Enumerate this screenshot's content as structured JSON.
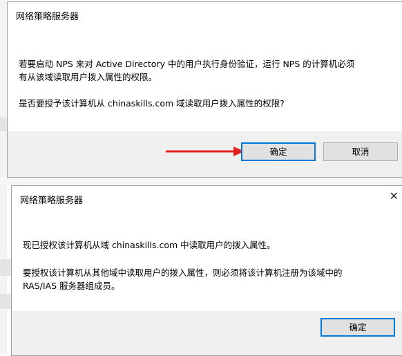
{
  "dialog1": {
    "title": "网络策略服务器",
    "close_glyph": "",
    "message_line1": "若要启动 NPS 来对 Active Directory 中的用户执行身份验证，运行 NPS 的计算机必须",
    "message_line2": "有从该域读取用户拨入属性的权限。",
    "question": "是否要授予该计算机从 chinaskills.com 域读取用户拨入属性的权限?",
    "ok_label": "确定",
    "cancel_label": "取消"
  },
  "dialog2": {
    "title": "网络策略服务器",
    "close_glyph": "✕",
    "message1": "现已授权该计算机从域 chinaskills.com 中读取用户的拨入属性。",
    "message2_line1": "要授权该计算机从其他域中读取用户的拨入属性，则必须将该计算机注册为该域中的",
    "message2_line2": "RAS/IAS 服务器组成员。",
    "ok_label": "确定"
  },
  "colors": {
    "accent": "#0078d7",
    "arrow": "#e02020",
    "footer": "#f0f0f0",
    "button": "#e1e1e1"
  }
}
